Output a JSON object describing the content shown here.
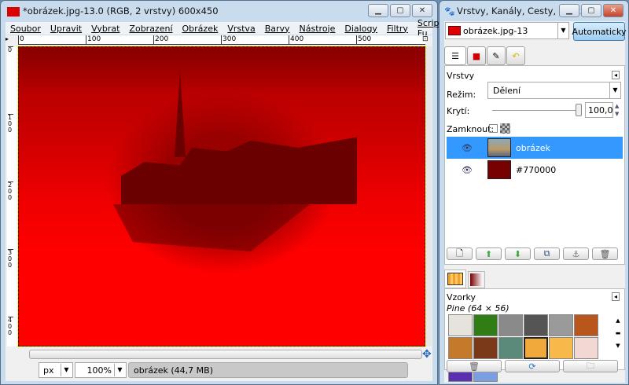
{
  "image_window": {
    "title": "*obrázek.jpg-13.0 (RGB, 2 vrstvy) 600x450",
    "menu": [
      "Soubor",
      "Upravit",
      "Vybrat",
      "Zobrazení",
      "Obrázek",
      "Vrstva",
      "Barvy",
      "Nástroje",
      "Dialogy",
      "Filtry",
      "Script-Fu"
    ],
    "ruler_h": [
      "0",
      "100",
      "200",
      "300",
      "400",
      "500"
    ],
    "ruler_v": [
      "0",
      "100",
      "200",
      "300",
      "400"
    ],
    "unit": "px",
    "zoom": "100%",
    "status": "obrázek (44,7 MB)"
  },
  "dock": {
    "title": "Vrstvy, Kanály, Cesty, Zpět...",
    "image_select": "obrázek.jpg-13",
    "auto_button": "Automaticky",
    "tabs": [
      "layers-icon",
      "channels-icon",
      "paths-icon",
      "undo-icon"
    ],
    "layers": {
      "heading": "Vrstvy",
      "mode_label": "Režim:",
      "mode": "Dělení",
      "opacity_label": "Krytí:",
      "opacity": "100,0",
      "lock_label": "Zamknout:",
      "items": [
        {
          "name": "obrázek",
          "selected": true,
          "visible": true
        },
        {
          "name": "#770000",
          "selected": false,
          "visible": true,
          "color": "#770000"
        }
      ]
    },
    "patterns": {
      "heading": "Vzorky",
      "selected": "Pine (64 × 56)",
      "swatches": [
        "#e6e2dc",
        "#2f7d14",
        "#8a8a8a",
        "#555",
        "#9a9a9a",
        "#b8561c",
        "#c47a2a",
        "#7a3a1a",
        "#5a8a7a",
        "#f0a93a",
        "#f7b94a",
        "#f1d8d2",
        "#5a2fb0",
        "#7b9ee0"
      ]
    }
  },
  "colors": {
    "accent": "#3399ff",
    "canvas": "#ff0000"
  }
}
